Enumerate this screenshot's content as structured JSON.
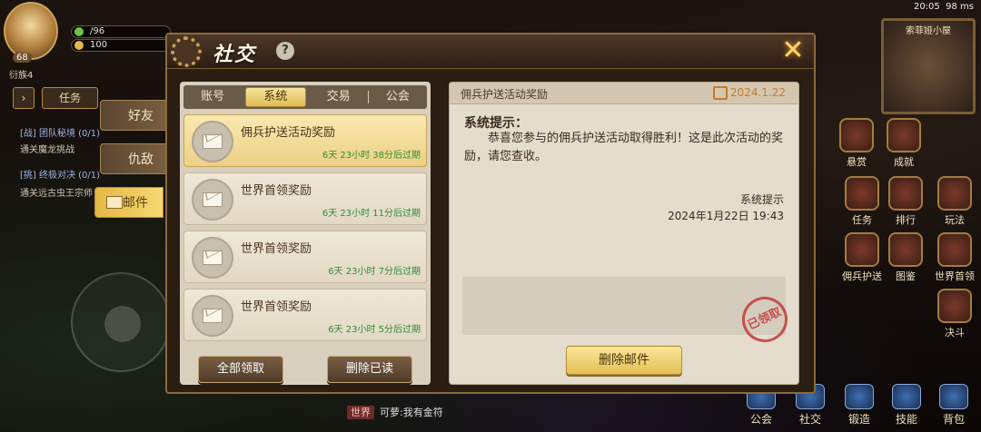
{
  "status": {
    "time": "20:05",
    "ping": "98 ms"
  },
  "player": {
    "level": "68",
    "rank": "衍族4",
    "energy": "/96",
    "gems": "100"
  },
  "hud": {
    "task_label": "任务"
  },
  "quests": [
    {
      "title": "[战] 团队秘境 (0/1)",
      "desc": "通关魔龙挑战"
    },
    {
      "title": "[挑] 终极对决 (0/1)",
      "desc": "通关远古虫王宗师"
    }
  ],
  "minimap": {
    "title": "索菲娅小屋"
  },
  "right_buttons": [
    "悬赏",
    "成就",
    "任务",
    "排行",
    "玩法",
    "佣兵护送",
    "图鉴",
    "世界首领",
    "决斗"
  ],
  "bottom_buttons": [
    "公会",
    "社交",
    "锻造",
    "技能",
    "背包"
  ],
  "chat": {
    "channel": "世界",
    "message": "可萝:我有金符"
  },
  "side_tabs": [
    {
      "label": "好友",
      "active": false
    },
    {
      "label": "仇敌",
      "active": false
    },
    {
      "label": "邮件",
      "active": true
    }
  ],
  "panel": {
    "title": "社交",
    "help": "?",
    "close": "✕",
    "tabs": [
      {
        "label": "账号",
        "active": false
      },
      {
        "label": "系统",
        "active": true
      },
      {
        "label": "交易",
        "active": false
      },
      {
        "label": "公会",
        "active": false
      }
    ],
    "mails": [
      {
        "title": "佣兵护送活动奖励",
        "expire": "6天 23小时 38分后过期",
        "selected": true
      },
      {
        "title": "世界首领奖励",
        "expire": "6天 23小时 11分后过期",
        "selected": false
      },
      {
        "title": "世界首领奖励",
        "expire": "6天 23小时 7分后过期",
        "selected": false
      },
      {
        "title": "世界首领奖励",
        "expire": "6天 23小时 5分后过期",
        "selected": false
      }
    ],
    "claim_all": "全部领取",
    "delete_read": "删除已读",
    "detail": {
      "subject": "佣兵护送活动奖励",
      "date": "2024.1.22",
      "heading": "系统提示：",
      "body": "恭喜您参与的佣兵护送活动取得胜利！这是此次活动的奖励，请您查收。",
      "signer": "系统提示",
      "sent_at": "2024年1月22日 19:43",
      "stamp": "已领取",
      "delete": "删除邮件"
    }
  },
  "colors": {
    "accent_gold": "#e4bf55",
    "expire_green": "#2f8a3a",
    "date_orange": "#c87a2a",
    "stamp_red": "#c43a3a"
  }
}
